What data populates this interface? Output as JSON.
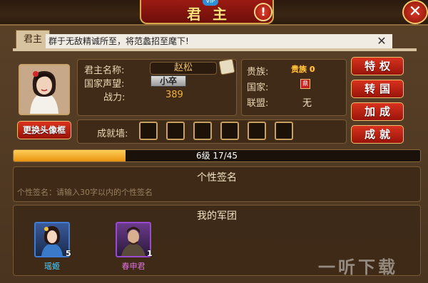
{
  "header": {
    "title": "君主",
    "vip": "VIP",
    "info": "!",
    "close": "✕"
  },
  "tab": {
    "label": "君主"
  },
  "notice": {
    "text": "群于无敌精诚所至，将范蠡招至麾下!",
    "close": "✕"
  },
  "profile": {
    "change_avatar_label": "更换头像框",
    "name_label": "君主名称:",
    "name_value": "赵松",
    "reputation_label": "国家声望:",
    "reputation_value": "小卒",
    "power_label": "战力:",
    "power_value": "389"
  },
  "status": {
    "noble_label": "贵族:",
    "noble_value": "贵族 0",
    "country_label": "国家:",
    "country_value": "鼎",
    "alliance_label": "联盟:",
    "alliance_value": "无"
  },
  "buttons": {
    "privilege": "特权",
    "change_country": "转国",
    "bonus": "加成",
    "achievement": "成就"
  },
  "achievement_wall": {
    "label": "成就墙:",
    "slots": 6
  },
  "level": {
    "text": "6级 17/45",
    "current": 17,
    "max": 45
  },
  "signature": {
    "title": "个性签名",
    "placeholder": "个性签名：请输入30字以内的个性签名"
  },
  "legion": {
    "title": "我的军团",
    "members": [
      {
        "name": "瑶姬",
        "count": "5",
        "name_color": "#5fd6ff"
      },
      {
        "name": "春申君",
        "count": "1",
        "name_color": "#e070e0"
      }
    ]
  },
  "watermark": "一听下载"
}
